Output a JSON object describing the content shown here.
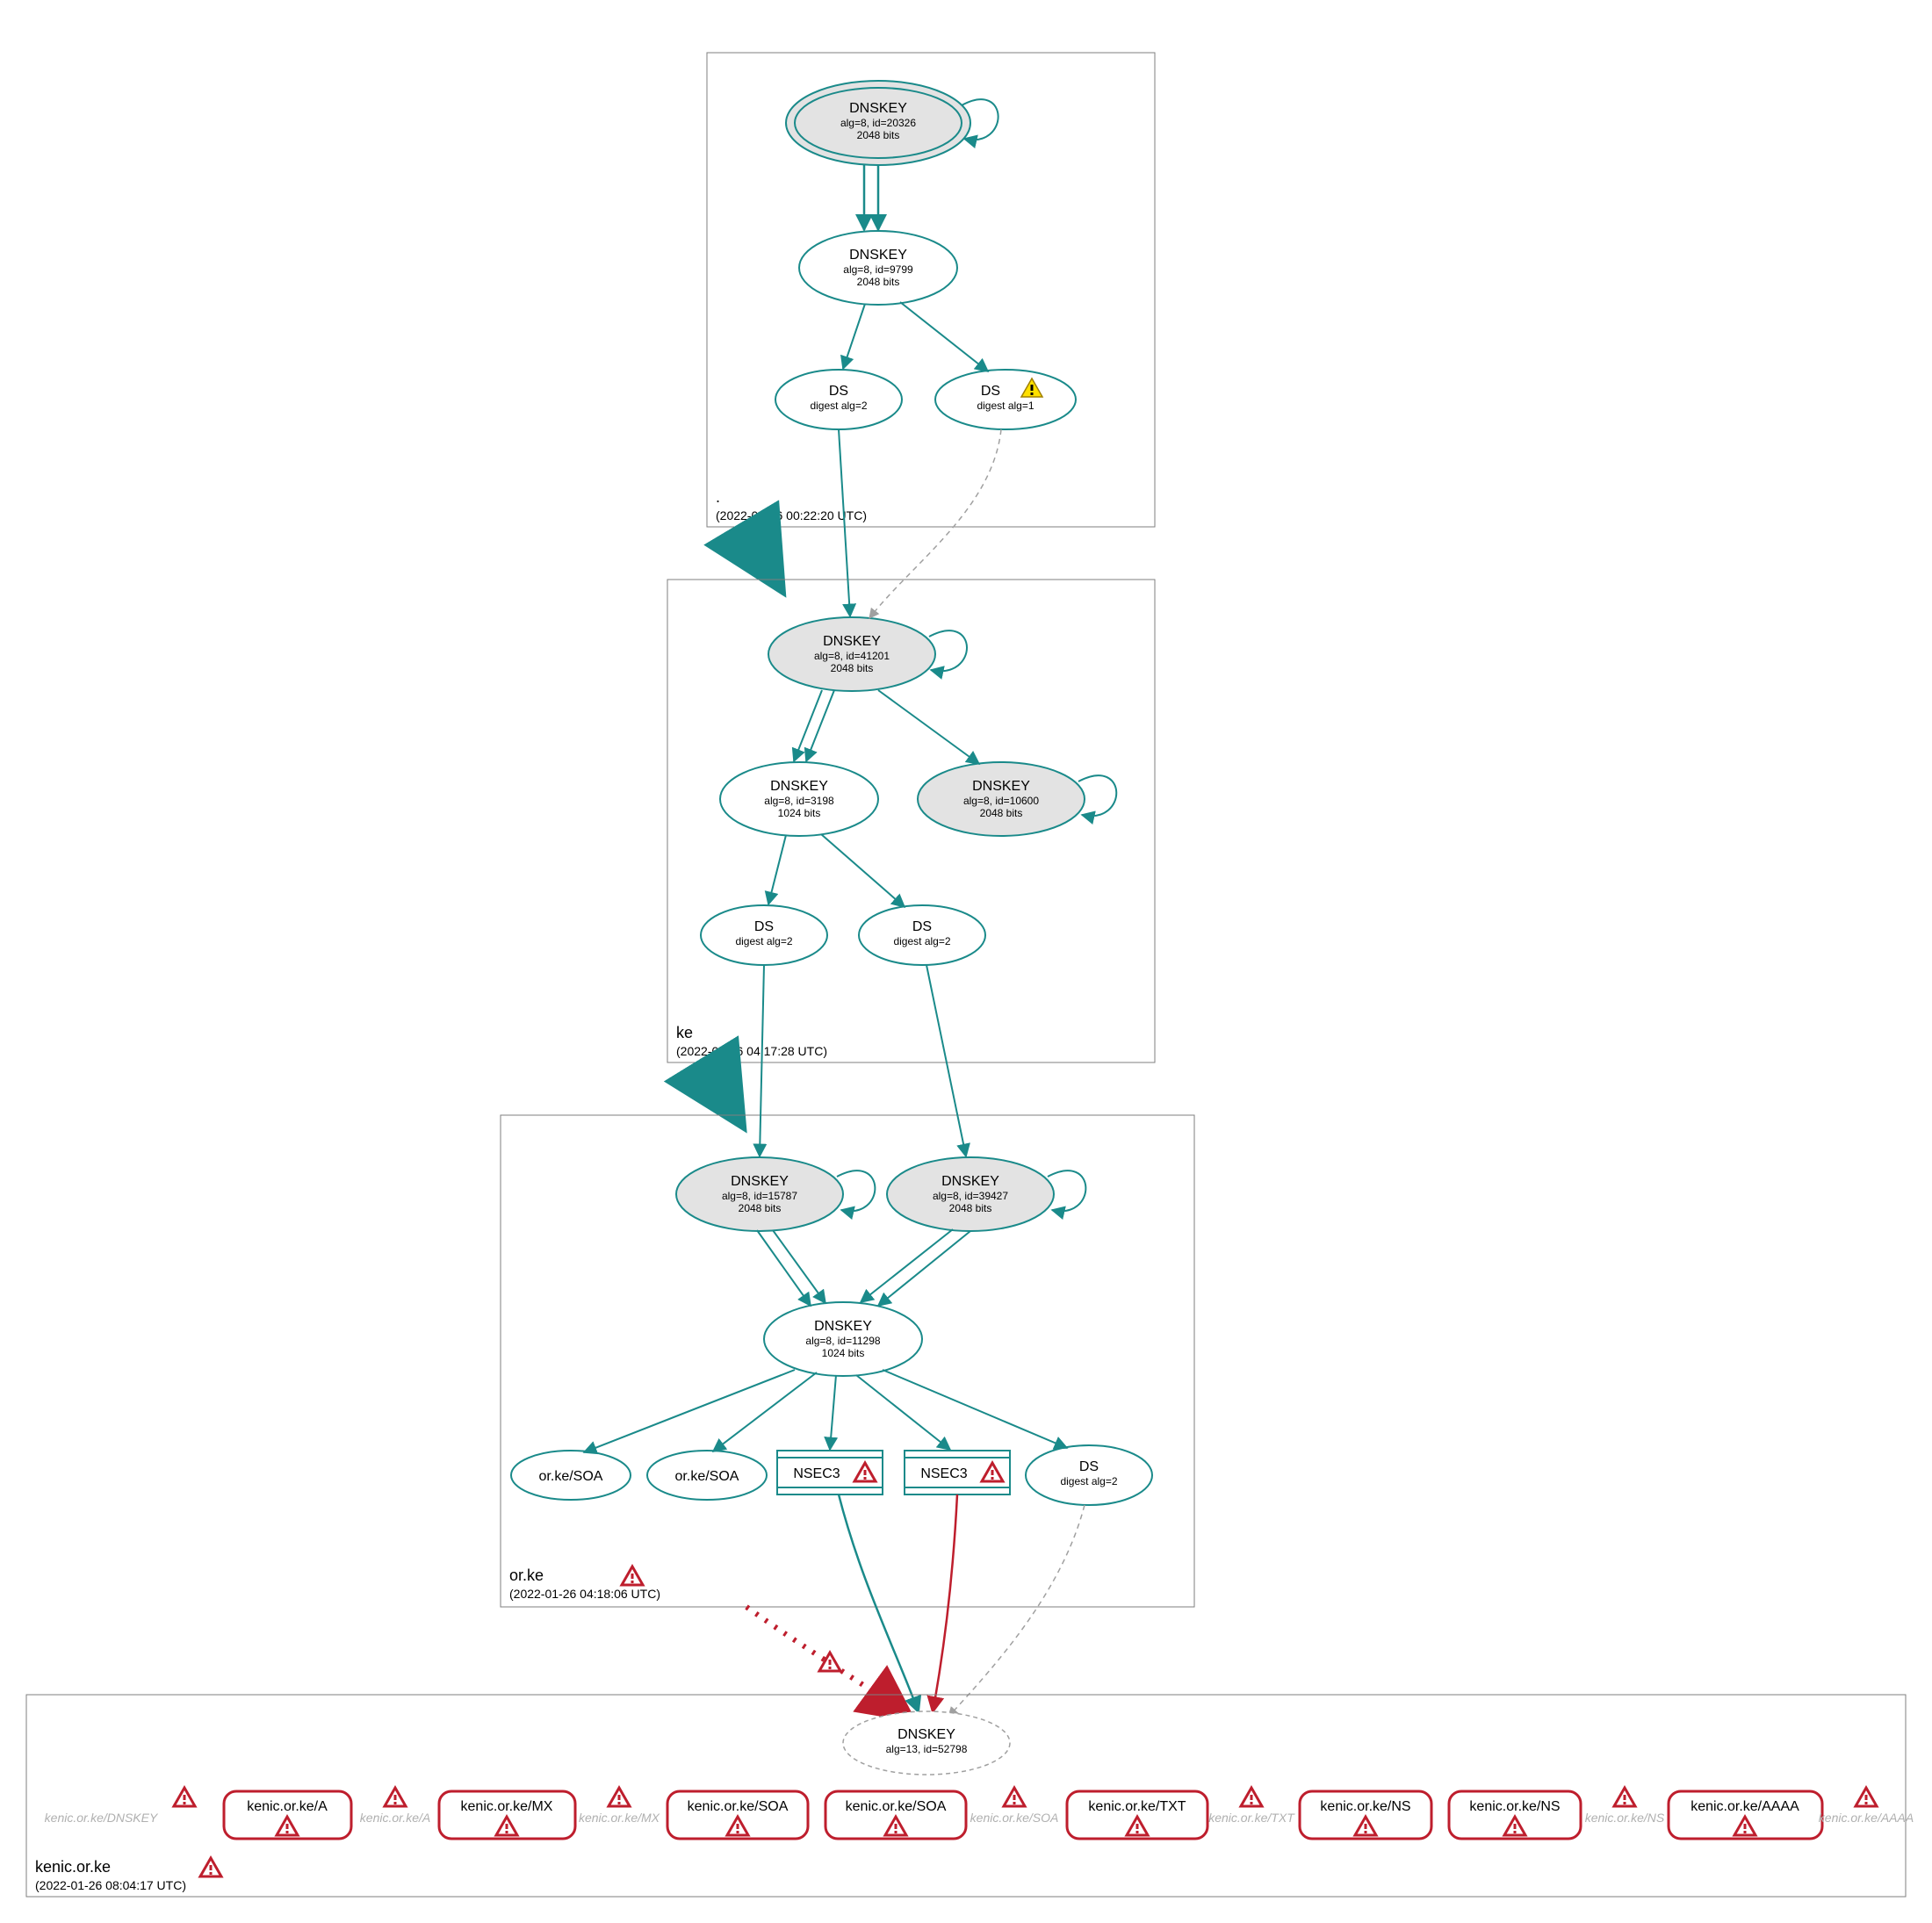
{
  "zones": {
    "root": {
      "name": ".",
      "timestamp": "(2022-01-26 00:22:20 UTC)",
      "dnskey_ksk": {
        "title": "DNSKEY",
        "line2": "alg=8, id=20326",
        "line3": "2048 bits"
      },
      "dnskey_zsk": {
        "title": "DNSKEY",
        "line2": "alg=8, id=9799",
        "line3": "2048 bits"
      },
      "ds1": {
        "title": "DS",
        "line2": "digest alg=2"
      },
      "ds2": {
        "title": "DS",
        "line2": "digest alg=1"
      }
    },
    "ke": {
      "name": "ke",
      "timestamp": "(2022-01-26 04:17:28 UTC)",
      "dnskey_ksk": {
        "title": "DNSKEY",
        "line2": "alg=8, id=41201",
        "line3": "2048 bits"
      },
      "dnskey_zsk": {
        "title": "DNSKEY",
        "line2": "alg=8, id=3198",
        "line3": "1024 bits"
      },
      "dnskey_old": {
        "title": "DNSKEY",
        "line2": "alg=8, id=10600",
        "line3": "2048 bits"
      },
      "ds1": {
        "title": "DS",
        "line2": "digest alg=2"
      },
      "ds2": {
        "title": "DS",
        "line2": "digest alg=2"
      }
    },
    "orke": {
      "name": "or.ke",
      "timestamp": "(2022-01-26 04:18:06 UTC)",
      "dnskey_ksk1": {
        "title": "DNSKEY",
        "line2": "alg=8, id=15787",
        "line3": "2048 bits"
      },
      "dnskey_ksk2": {
        "title": "DNSKEY",
        "line2": "alg=8, id=39427",
        "line3": "2048 bits"
      },
      "dnskey_zsk": {
        "title": "DNSKEY",
        "line2": "alg=8, id=11298",
        "line3": "1024 bits"
      },
      "soa1": "or.ke/SOA",
      "soa2": "or.ke/SOA",
      "nsec1": "NSEC3",
      "nsec2": "NSEC3",
      "ds": {
        "title": "DS",
        "line2": "digest alg=2"
      }
    },
    "kenic": {
      "name": "kenic.or.ke",
      "timestamp": "(2022-01-26 08:04:17 UTC)",
      "dnskey": {
        "title": "DNSKEY",
        "line2": "alg=13, id=52798"
      },
      "ghosts": {
        "dnskey": "kenic.or.ke/DNSKEY",
        "a": "kenic.or.ke/A",
        "mx": "kenic.or.ke/MX",
        "soa": "kenic.or.ke/SOA",
        "txt": "kenic.or.ke/TXT",
        "ns": "kenic.or.ke/NS",
        "aaaa": "kenic.or.ke/AAAA"
      },
      "rr": {
        "a": "kenic.or.ke/A",
        "mx": "kenic.or.ke/MX",
        "soa1": "kenic.or.ke/SOA",
        "soa2": "kenic.or.ke/SOA",
        "txt": "kenic.or.ke/TXT",
        "ns1": "kenic.or.ke/NS",
        "ns2": "kenic.or.ke/NS",
        "aaaa": "kenic.or.ke/AAAA"
      }
    }
  }
}
